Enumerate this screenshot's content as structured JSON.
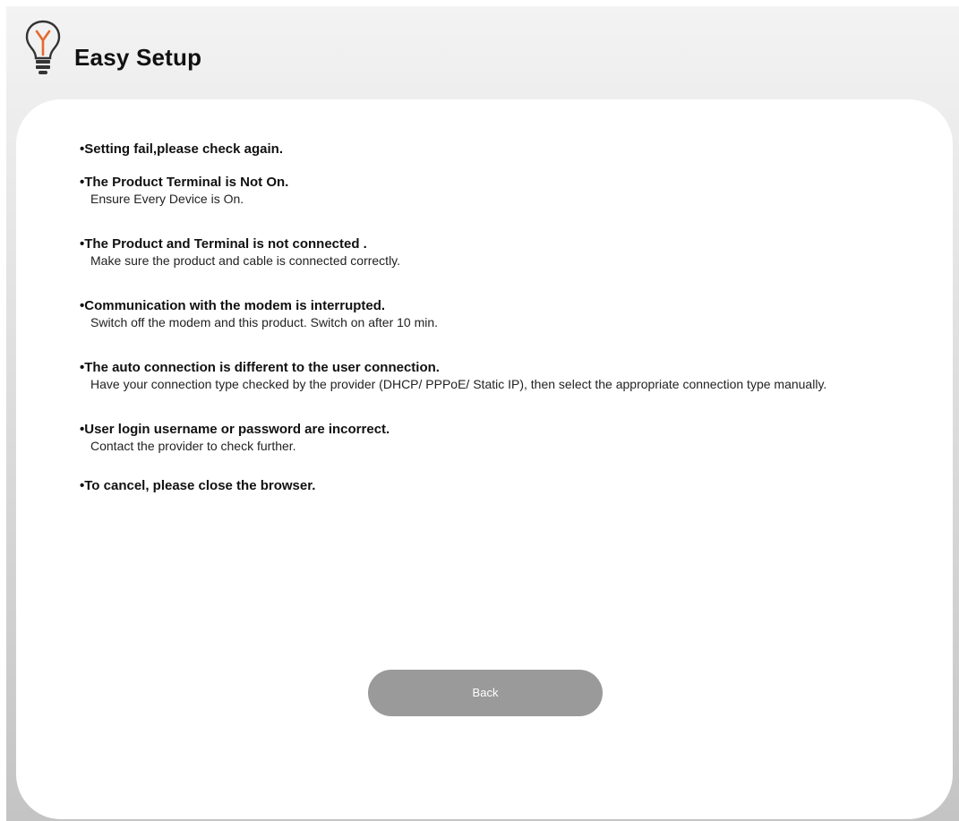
{
  "header": {
    "title": "Easy Setup",
    "logo_icon": "lightbulb-icon",
    "accent_color": "#e56a2c"
  },
  "messages": [
    {
      "title": "•Setting fail,please check again.",
      "description": ""
    },
    {
      "title": "•The Product Terminal is Not On.",
      "description": "Ensure Every Device is On."
    },
    {
      "title": "•The Product and Terminal is not connected .",
      "description": "Make sure the product and cable is connected correctly."
    },
    {
      "title": "•Communication with the modem is interrupted.",
      "description": "Switch off the modem and this product. Switch on after 10 min."
    },
    {
      "title": "•The auto connection is different to the user connection.",
      "description": "Have your connection type checked by the provider (DHCP/ PPPoE/ Static IP), then select the appropriate connection type manually."
    },
    {
      "title": "•User login username or password are incorrect.",
      "description": "Contact the provider to check further."
    },
    {
      "title": "•To cancel, please close the browser.",
      "description": ""
    }
  ],
  "actions": {
    "back_label": "Back"
  }
}
